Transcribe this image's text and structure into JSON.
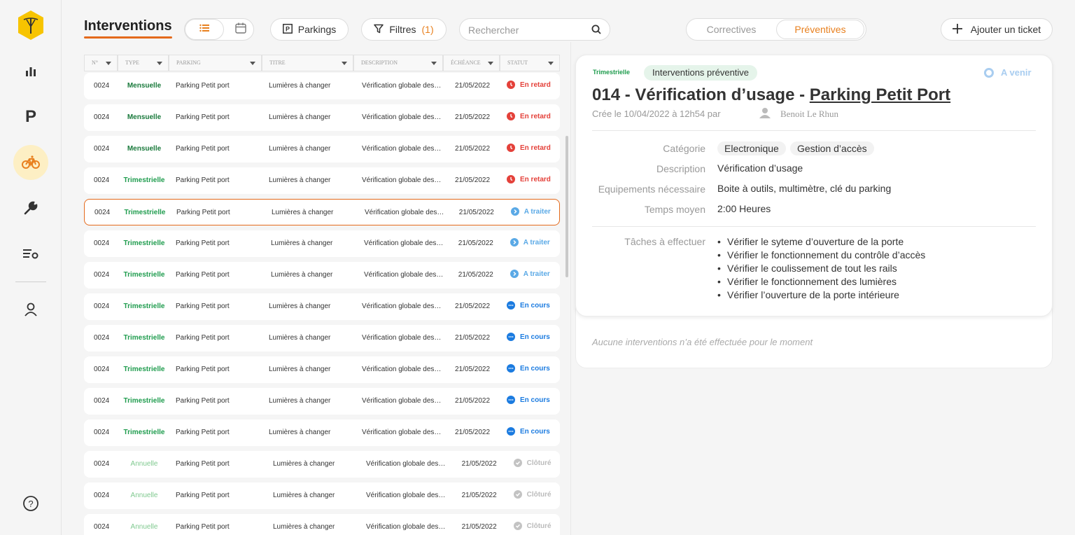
{
  "header": {
    "title": "Interventions",
    "parkings_label": "Parkings",
    "filters_label": "Filtres",
    "filters_count": "(1)",
    "search_placeholder": "Rechercher",
    "seg_correctives": "Correctives",
    "seg_preventives": "Préventives",
    "add_ticket": "Ajouter un ticket"
  },
  "colors": {
    "accent": "#e46a1c",
    "green": "#1f9c4e",
    "light_green": "#7fc98f",
    "red": "#e4413a",
    "blue_light": "#5aa9e6",
    "blue": "#1b7be0",
    "grey": "#c3c3c3"
  },
  "table": {
    "columns": [
      "N°",
      "TYPE",
      "PARKING",
      "TITRE",
      "DESCRIPTION",
      "ÉCHÉANCE",
      "STATUT"
    ],
    "rows": [
      {
        "num": "0024",
        "type": "Mensuelle",
        "parking": "Parking Petit port",
        "titre": "Lumières à changer",
        "desc": "Vérification globale des…",
        "date": "21/05/2022",
        "status": "En retard",
        "kind": "late"
      },
      {
        "num": "0024",
        "type": "Mensuelle",
        "parking": "Parking Petit port",
        "titre": "Lumières à changer",
        "desc": "Vérification globale des…",
        "date": "21/05/2022",
        "status": "En retard",
        "kind": "late"
      },
      {
        "num": "0024",
        "type": "Mensuelle",
        "parking": "Parking Petit port",
        "titre": "Lumières à changer",
        "desc": "Vérification globale des…",
        "date": "21/05/2022",
        "status": "En retard",
        "kind": "late"
      },
      {
        "num": "0024",
        "type": "Trimestrielle",
        "parking": "Parking Petit port",
        "titre": "Lumières à changer",
        "desc": "Vérification globale des…",
        "date": "21/05/2022",
        "status": "En retard",
        "kind": "late"
      },
      {
        "num": "0024",
        "type": "Trimestrielle",
        "parking": "Parking Petit port",
        "titre": "Lumières à changer",
        "desc": "Vérification globale des…",
        "date": "21/05/2022",
        "status": "A traiter",
        "kind": "todo",
        "selected": true
      },
      {
        "num": "0024",
        "type": "Trimestrielle",
        "parking": "Parking Petit port",
        "titre": "Lumières à changer",
        "desc": "Vérification globale des…",
        "date": "21/05/2022",
        "status": "A traiter",
        "kind": "todo"
      },
      {
        "num": "0024",
        "type": "Trimestrielle",
        "parking": "Parking Petit port",
        "titre": "Lumières à changer",
        "desc": "Vérification globale des…",
        "date": "21/05/2022",
        "status": "A traiter",
        "kind": "todo"
      },
      {
        "num": "0024",
        "type": "Trimestrielle",
        "parking": "Parking Petit port",
        "titre": "Lumières à changer",
        "desc": "Vérification globale des…",
        "date": "21/05/2022",
        "status": "En cours",
        "kind": "progress"
      },
      {
        "num": "0024",
        "type": "Trimestrielle",
        "parking": "Parking Petit port",
        "titre": "Lumières à changer",
        "desc": "Vérification globale des…",
        "date": "21/05/2022",
        "status": "En cours",
        "kind": "progress"
      },
      {
        "num": "0024",
        "type": "Trimestrielle",
        "parking": "Parking Petit port",
        "titre": "Lumières à changer",
        "desc": "Vérification globale des…",
        "date": "21/05/2022",
        "status": "En cours",
        "kind": "progress"
      },
      {
        "num": "0024",
        "type": "Trimestrielle",
        "parking": "Parking Petit port",
        "titre": "Lumières à changer",
        "desc": "Vérification globale des…",
        "date": "21/05/2022",
        "status": "En cours",
        "kind": "progress"
      },
      {
        "num": "0024",
        "type": "Trimestrielle",
        "parking": "Parking Petit port",
        "titre": "Lumières à changer",
        "desc": "Vérification globale des…",
        "date": "21/05/2022",
        "status": "En cours",
        "kind": "progress"
      },
      {
        "num": "0024",
        "type": "Annuelle",
        "parking": "Parking Petit port",
        "titre": "Lumières à changer",
        "desc": "Vérification globale des…",
        "date": "21/05/2022",
        "status": "Clôturé",
        "kind": "closed"
      },
      {
        "num": "0024",
        "type": "Annuelle",
        "parking": "Parking Petit port",
        "titre": "Lumières à changer",
        "desc": "Vérification globale des…",
        "date": "21/05/2022",
        "status": "Clôturé",
        "kind": "closed"
      },
      {
        "num": "0024",
        "type": "Annuelle",
        "parking": "Parking Petit port",
        "titre": "Lumières à changer",
        "desc": "Vérification globale des…",
        "date": "21/05/2022",
        "status": "Clôturé",
        "kind": "closed"
      }
    ]
  },
  "detail": {
    "frequency": "Trimestrielle",
    "type_badge": "Interventions préventive",
    "status": "A venir",
    "title_prefix": "014 - Vérification d’usage - ",
    "title_link": "Parking Petit Port",
    "created": "Crée le 10/04/2022 à 12h54 par",
    "author": "Benoit Le Rhun",
    "category_label": "Catégorie",
    "categories": [
      "Electronique",
      "Gestion d’accès"
    ],
    "description_label": "Description",
    "description": "Vérification d’usage",
    "equipment_label": "Equipements nécessaire",
    "equipment": "Boite à outils, multimètre, clé du parking",
    "time_label": "Temps moyen",
    "time": "2:00 Heures",
    "tasks_label": "Tâches à effectuer",
    "tasks": [
      "Vérifier le syteme d’ouverture de la porte",
      "Vérifier le fonctionnement du contrôle d’accès",
      "Vérifier le coulissement de tout les rails",
      "Vérifier le fonctionnement des lumières",
      "Vérifier l’ouverture de la porte intérieure"
    ],
    "empty_note": "Aucune interventions n’a été effectuée pour le moment"
  },
  "sidebar": {
    "items": [
      "logo-icon",
      "stats-icon",
      "parking-icon",
      "bike-icon",
      "wrench-icon",
      "settings-list-icon",
      "user-icon",
      "help-icon"
    ]
  }
}
